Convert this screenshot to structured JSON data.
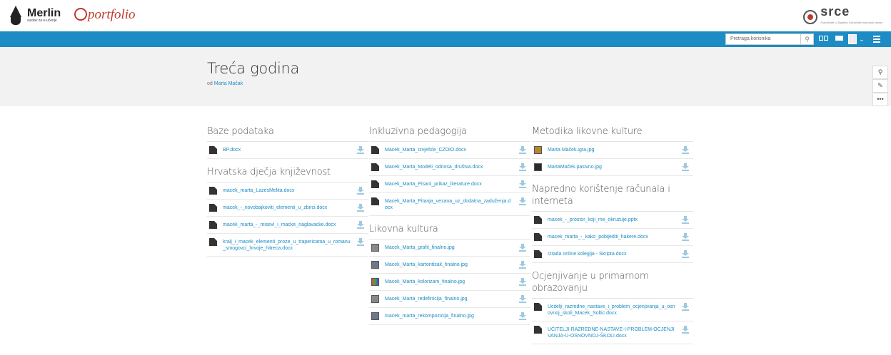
{
  "header": {
    "merlin_logo": "Merlin",
    "merlin_sub": "sustav za e-učenje",
    "portfolio_logo": "portfolio",
    "srce_logo": "srce",
    "srce_sub": "Sveučilište u Zagrebu Sveučilišni računski centar"
  },
  "navbar": {
    "search_placeholder": "Pretraga korisnika",
    "color": "#1d8cc4"
  },
  "page": {
    "title": "Treća godina",
    "author_prefix": "od",
    "author_name": "Marta Mačak"
  },
  "columns": [
    {
      "blocks": [
        {
          "title": "Baze podataka",
          "files": [
            {
              "name": "BP.docx",
              "icon": "doc"
            }
          ]
        },
        {
          "title": "Hrvatska dječja književnost",
          "files": [
            {
              "name": "macek_marta_LazesMelita.docx",
              "icon": "doc"
            },
            {
              "name": "macek_-_novobajkoviti_elementi_u_zbirci.docx",
              "icon": "doc"
            },
            {
              "name": "macek_marta_-_misevi_i_macke_naglavacke.docx",
              "icon": "doc"
            },
            {
              "name": "kralj_i_macek_elementi_proze_u_trapericama_u_romanu_smogovci_hrvoje_hitreca.docx",
              "icon": "doc"
            }
          ]
        }
      ]
    },
    {
      "blocks": [
        {
          "title": "Inkluzivna pedagogija",
          "files": [
            {
              "name": "Macek_Marta_Izvješće_CZOiO.docx",
              "icon": "doc"
            },
            {
              "name": "Macek_Marta_Modeli_odnosa_društva.docx",
              "icon": "doc"
            },
            {
              "name": "Macek_Marta_Pisani_prikaz_literature.docx",
              "icon": "doc"
            },
            {
              "name": "Macek_Marta_Pitanja_vezana_uz_dodatna_zaduženja.docx",
              "icon": "doc"
            }
          ]
        },
        {
          "title": "Likovna kultura",
          "files": [
            {
              "name": "Macek_Marta_grafit_finalno.jpg",
              "icon": "img-grey"
            },
            {
              "name": "Macek_Marta_kartontisak_finalno.jpg",
              "icon": "img"
            },
            {
              "name": "Macek_Marta_kolorizam_finalno.jpg",
              "icon": "img-multi"
            },
            {
              "name": "Macek_Marta_redefinicija_finalno.jpg",
              "icon": "img-grey"
            },
            {
              "name": "macek_marta_rekompozicija_finalno.jpg",
              "icon": "img"
            }
          ]
        }
      ]
    },
    {
      "blocks": [
        {
          "title": "Metodika likovne kulture",
          "files": [
            {
              "name": "Marta Maček.igra.jpg",
              "icon": "img-warm"
            },
            {
              "name": "MartaMaček.pasivno.jpg",
              "icon": "img-dark"
            }
          ]
        },
        {
          "title": "Napredno korištenje računala i interneta",
          "files": [
            {
              "name": "macek_-_prostor_koji_me_okruzuje.pptx",
              "icon": "doc"
            },
            {
              "name": "macek_marta_-_kako_pobijediti_hakere.docx",
              "icon": "doc"
            },
            {
              "name": "Izrada online kolegija - Skripta.docx",
              "icon": "doc"
            }
          ]
        },
        {
          "title": "Ocjenjivanje u primarnom obrazovanju",
          "files": [
            {
              "name": "Ucitelji_razredne_nastave_i_problem_ocjenjivanja_u_osnovnoj_skoli_Macek_Soltic.docx",
              "icon": "doc"
            },
            {
              "name": "UČITELJI-RAZREDNE-NASTAVE-I-PROBLEM-OCJENJIVANJA-U-OSNOVNOJ-ŠKOLI.docx",
              "icon": "doc"
            }
          ]
        }
      ]
    }
  ]
}
